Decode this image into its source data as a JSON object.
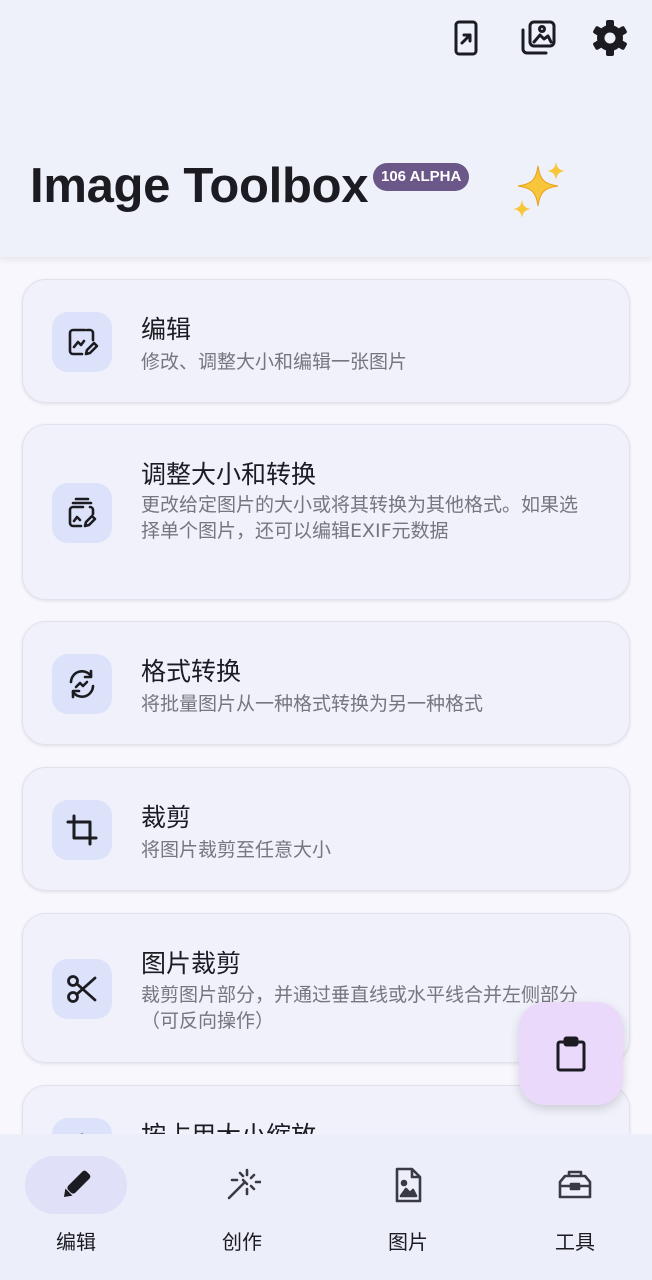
{
  "app": {
    "title": "Image Toolbox",
    "version_badge": "106 ALPHA"
  },
  "top_actions": [
    {
      "icon": "share-screen-icon"
    },
    {
      "icon": "gallery-icon"
    },
    {
      "icon": "gear-icon"
    }
  ],
  "tools": [
    {
      "title": "编辑",
      "description": "修改、调整大小和编辑一张图片",
      "icon": "image-edit-icon"
    },
    {
      "title": "调整大小和转换",
      "description": "更改给定图片的大小或将其转换为其他格式。如果选择单个图片，还可以编辑EXIF元数据",
      "icon": "stack-edit-icon"
    },
    {
      "title": "格式转换",
      "description": "将批量图片从一种格式转换为另一种格式",
      "icon": "convert-icon"
    },
    {
      "title": "裁剪",
      "description": "将图片裁剪至任意大小",
      "icon": "crop-icon"
    },
    {
      "title": "图片裁剪",
      "description": "裁剪图片部分，并通过垂直线或水平线合并左侧部分（可反向操作）",
      "icon": "scissors-icon"
    },
    {
      "title": "按占用大小缩放",
      "description": "",
      "icon": "weight-icon"
    }
  ],
  "fab": {
    "icon": "clipboard-icon"
  },
  "bottom_nav": [
    {
      "label": "编辑",
      "icon": "pencil-icon",
      "active": true
    },
    {
      "label": "创作",
      "icon": "magic-wand-icon",
      "active": false
    },
    {
      "label": "图片",
      "icon": "image-file-icon",
      "active": false
    },
    {
      "label": "工具",
      "icon": "toolbox-icon",
      "active": false
    }
  ],
  "colors": {
    "background": "#f7f7fd",
    "topbar": "#eef0fa",
    "card": "#f0f1fb",
    "icon_container": "#dbe2f9",
    "badge": "#6b5788",
    "fab": "#ead9fb",
    "nav_active": "#e1e0f9",
    "icon_stroke": "#1b1b21"
  }
}
